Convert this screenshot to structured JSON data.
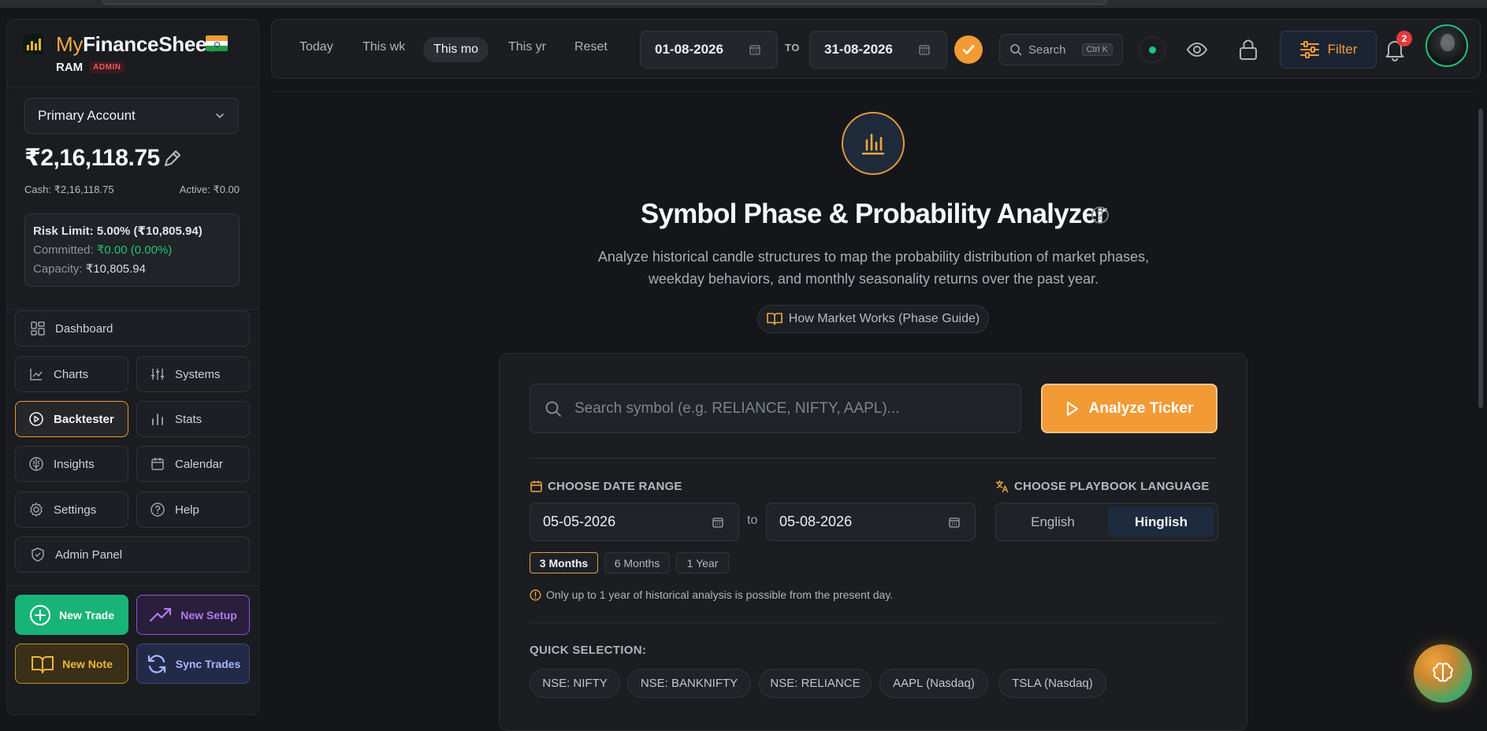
{
  "brand": {
    "name_part1": "My",
    "name_part2": "FinanceSheet",
    "user": "RAM",
    "role_badge": "ADMIN"
  },
  "account": {
    "selected": "Primary Account",
    "balance": "₹2,16,118.75",
    "cash": "Cash: ₹2,16,118.75",
    "active": "Active: ₹0.00",
    "risk_limit": "Risk Limit: 5.00% (₹10,805.94)",
    "committed_label": "Committed:",
    "committed_value": "₹0.00 (0.00%)",
    "capacity_label": "Capacity:",
    "capacity_value": "₹10,805.94"
  },
  "nav": {
    "dashboard": "Dashboard",
    "charts": "Charts",
    "systems": "Systems",
    "backtester": "Backtester",
    "stats": "Stats",
    "insights": "Insights",
    "calendar": "Calendar",
    "settings": "Settings",
    "help": "Help",
    "admin_panel": "Admin Panel"
  },
  "actions": {
    "new_trade": "New Trade",
    "new_setup": "New Setup",
    "new_note": "New Note",
    "sync_trades": "Sync Trades"
  },
  "topbar": {
    "today": "Today",
    "this_wk": "This wk",
    "this_mo": "This mo",
    "this_yr": "This yr",
    "reset": "Reset",
    "date_from": "01-08-2026",
    "to_label": "TO",
    "date_to": "31-08-2026",
    "search_label": "Search",
    "search_shortcut": "Ctrl K",
    "filter_label": "Filter",
    "notification_count": "2"
  },
  "page": {
    "title": "Symbol Phase & Probability Analyzer",
    "subtitle_line1": "Analyze historical candle structures to map the probability distribution of market phases,",
    "subtitle_line2": "weekday behaviors, and monthly seasonality returns over the past year.",
    "guide_button": "How Market Works (Phase Guide)"
  },
  "analyzer": {
    "search_placeholder": "Search symbol (e.g. RELIANCE, NIFTY, AAPL)...",
    "analyze_button": "Analyze Ticker",
    "date_range_label": "CHOOSE DATE RANGE",
    "range_from": "05-05-2026",
    "range_to_label": "to",
    "range_to": "05-08-2026",
    "language_label": "CHOOSE PLAYBOOK LANGUAGE",
    "lang_english": "English",
    "lang_hinglish": "Hinglish",
    "presets": [
      "3 Months",
      "6 Months",
      "1 Year"
    ],
    "note": "Only up to 1 year of historical analysis is possible from the present day.",
    "quick_label": "QUICK SELECTION:",
    "quick_chips": [
      "NSE: NIFTY",
      "NSE: BANKNIFTY",
      "NSE: RELIANCE",
      "AAPL (Nasdaq)",
      "TSLA (Nasdaq)"
    ]
  },
  "colors": {
    "accent": "#f29b35",
    "success": "#20c37a",
    "danger": "#e23b3b",
    "background": "#141619"
  }
}
